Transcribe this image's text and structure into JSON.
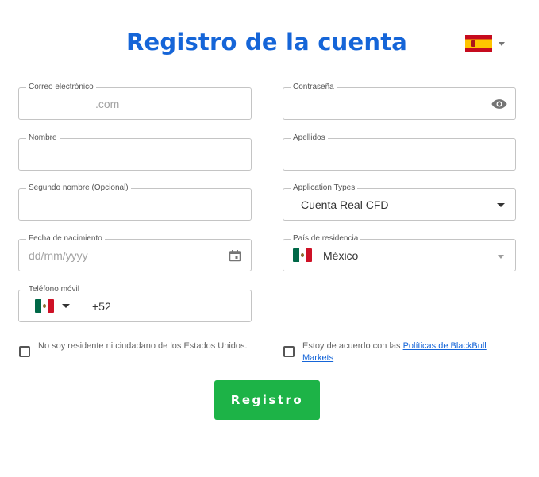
{
  "header": {
    "title": "Registro de la cuenta",
    "language_flag": "spain-flag-icon"
  },
  "form": {
    "email": {
      "label": "Correo electrónico",
      "value": ".com"
    },
    "password": {
      "label": "Contraseña",
      "value": ""
    },
    "first_name": {
      "label": "Nombre",
      "value": ""
    },
    "last_name": {
      "label": "Apellidos",
      "value": ""
    },
    "middle_name": {
      "label": "Segundo nombre (Opcional)",
      "value": ""
    },
    "application_type": {
      "label": "Application Types",
      "value": "Cuenta Real CFD"
    },
    "birth_date": {
      "label": "Fecha de nacimiento",
      "placeholder": "dd/mm/yyyy"
    },
    "country": {
      "label": "País de residencia",
      "value": "México"
    },
    "phone": {
      "label": "Teléfono móvil",
      "prefix": "+52"
    }
  },
  "checks": {
    "not_us": {
      "text": "No soy residente ni ciudadano de los Estados Unidos.",
      "checked": false
    },
    "policies": {
      "text": "Estoy de acuerdo con las ",
      "link": "Políticas de BlackBull Markets",
      "checked": false
    }
  },
  "submit_label": "Registro",
  "colors": {
    "title": "#1565d8",
    "submit": "#1db347",
    "link": "#1565d8"
  }
}
